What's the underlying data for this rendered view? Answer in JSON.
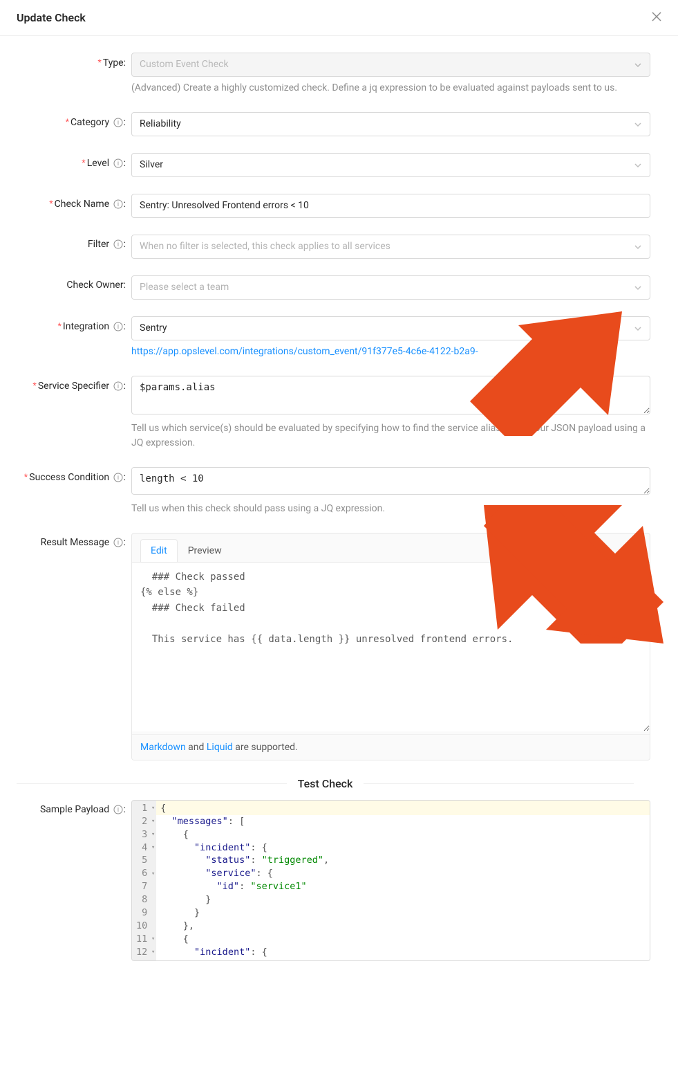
{
  "modal": {
    "title": "Update Check"
  },
  "form": {
    "type": {
      "label": "Type",
      "value": "Custom Event Check",
      "hint": "(Advanced) Create a highly customized check. Define a jq expression to be evaluated against payloads sent to us."
    },
    "category": {
      "label": "Category",
      "value": "Reliability"
    },
    "level": {
      "label": "Level",
      "value": "Silver"
    },
    "check_name": {
      "label": "Check Name",
      "value": "Sentry: Unresolved Frontend errors < 10"
    },
    "filter": {
      "label": "Filter",
      "placeholder": "When no filter is selected, this check applies to all services"
    },
    "check_owner": {
      "label": "Check Owner",
      "placeholder": "Please select a team"
    },
    "integration": {
      "label": "Integration",
      "value": "Sentry",
      "link": "https://app.opslevel.com/integrations/custom_event/91f377e5-4c6e-4122-b2a9-"
    },
    "service_specifier": {
      "label": "Service Specifier",
      "value": "$params.alias",
      "hint": "Tell us which service(s) should be evaluated by specifying how to find the service alias(es) in your JSON payload using a JQ expression."
    },
    "success_condition": {
      "label": "Success Condition",
      "value": "length < 10",
      "hint": "Tell us when this check should pass using a JQ expression."
    },
    "result_message": {
      "label": "Result Message",
      "tabs": {
        "edit": "Edit",
        "preview": "Preview"
      },
      "body": "  ### Check passed\n{% else %}\n  ### Check failed\n\n  This service has {{ data.length }} unresolved frontend errors.\n\n\n",
      "footer_pre": "Markdown",
      "footer_mid": " and ",
      "footer_link2": "Liquid",
      "footer_post": " are supported."
    }
  },
  "divider": {
    "test_check": "Test Check"
  },
  "sample_payload": {
    "label": "Sample Payload",
    "lines": [
      "{",
      "  \"messages\": [",
      "    {",
      "      \"incident\": {",
      "        \"status\": \"triggered\",",
      "        \"service\": {",
      "          \"id\": \"service1\"",
      "        }",
      "      }",
      "    },",
      "    {",
      "      \"incident\": {"
    ],
    "gutter": [
      {
        "n": "1",
        "fold": true
      },
      {
        "n": "2",
        "fold": true
      },
      {
        "n": "3",
        "fold": true
      },
      {
        "n": "4",
        "fold": true
      },
      {
        "n": "5",
        "fold": false
      },
      {
        "n": "6",
        "fold": true
      },
      {
        "n": "7",
        "fold": false
      },
      {
        "n": "8",
        "fold": false
      },
      {
        "n": "9",
        "fold": false
      },
      {
        "n": "10",
        "fold": false
      },
      {
        "n": "11",
        "fold": true
      },
      {
        "n": "12",
        "fold": true
      }
    ]
  }
}
